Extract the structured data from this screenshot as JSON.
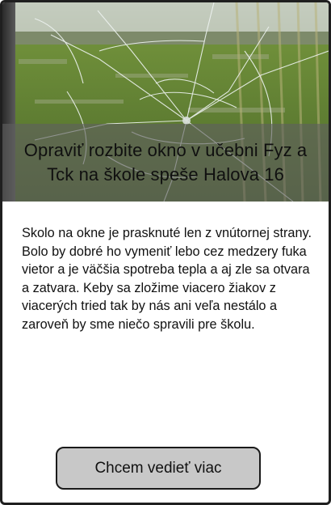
{
  "card": {
    "title": "Opraviť rozbite okno v učebni Fyz a Tck na škole speše Halova 16",
    "description": "Skolo  na okne je prasknuté len z vnútornej strany. Bolo by dobré ho vymeniť lebo cez medzery fuka vietor a je väčšia spotreba tepla a aj zle sa otvara a zatvara. Keby sa zložime viacero žiakov z viacerých tried tak by nás ani veľa nestálo a zaroveň by sme niečo spravili pre školu.",
    "cta_label": "Chcem vedieť viac",
    "image_subject": "cracked-window-glass-photo",
    "title_band_color": "#5f5f5f",
    "button_color": "#c8c8c8",
    "border_color": "#1f1f1f"
  }
}
